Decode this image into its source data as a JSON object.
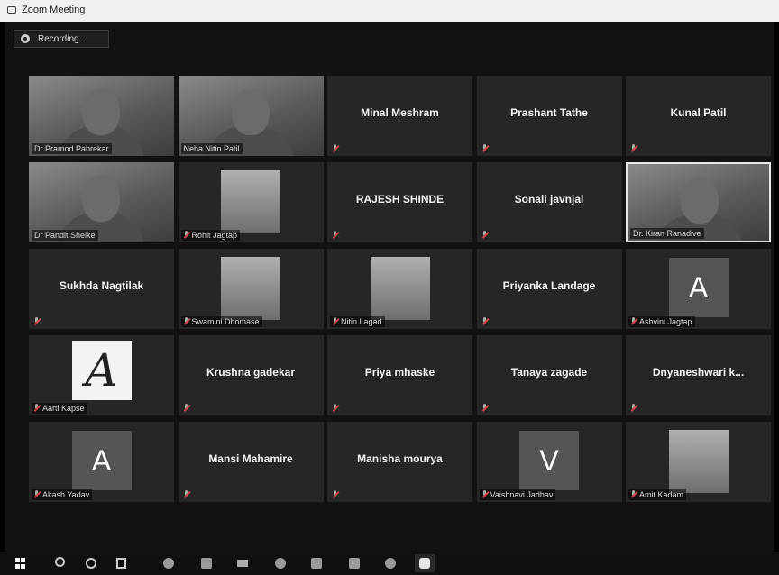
{
  "window": {
    "title": "Zoom Meeting"
  },
  "recording": {
    "label": "Recording..."
  },
  "participants": [
    {
      "name": "Dr Pramod Pabrekar",
      "display": "video"
    },
    {
      "name": "Neha Nitin Patil",
      "display": "video"
    },
    {
      "name": "Minal Meshram",
      "display": "name"
    },
    {
      "name": "Prashant Tathe",
      "display": "name"
    },
    {
      "name": "Kunal Patil",
      "display": "name"
    },
    {
      "name": "Dr Pandit Shelke",
      "display": "video"
    },
    {
      "name": "Rohit Jagtap",
      "display": "picture"
    },
    {
      "name": "RAJESH SHINDE",
      "display": "name"
    },
    {
      "name": "Sonali javnjal",
      "display": "name"
    },
    {
      "name": "Dr. Kiran Ranadive",
      "display": "video",
      "active": true
    },
    {
      "name": "Sukhda Nagtilak",
      "display": "name"
    },
    {
      "name": "Swamini Dhomase",
      "display": "picture"
    },
    {
      "name": "Nitin Lagad",
      "display": "picture"
    },
    {
      "name": "Priyanka Landage",
      "display": "name"
    },
    {
      "name": "Ashvini Jagtap",
      "display": "letter",
      "letter": "A"
    },
    {
      "name": "Aarti Kapse",
      "display": "script",
      "letter": "A"
    },
    {
      "name": "Krushna gadekar",
      "display": "name"
    },
    {
      "name": "Priya mhaske",
      "display": "name"
    },
    {
      "name": "Tanaya zagade",
      "display": "name"
    },
    {
      "name": "Dnyaneshwari k...",
      "display": "name"
    },
    {
      "name": "Akash Yadav",
      "display": "letter",
      "letter": "A"
    },
    {
      "name": "Mansi Mahamire",
      "display": "name"
    },
    {
      "name": "Manisha mourya",
      "display": "name"
    },
    {
      "name": "Vaishnavi Jadhav",
      "display": "letter",
      "letter": "V"
    },
    {
      "name": "Amit Kadam",
      "display": "picture"
    }
  ],
  "taskbar": {
    "items": [
      "start-icon",
      "search-icon",
      "cortana-icon",
      "task-view-icon",
      "chrome-icon",
      "file-explorer-icon",
      "mail-icon",
      "edge-icon",
      "store-icon",
      "notes-icon",
      "photos-icon",
      "zoom-icon"
    ]
  },
  "colors": {
    "tile": "#262626",
    "stage": "#121212",
    "active_border": "#e8e8e8"
  }
}
